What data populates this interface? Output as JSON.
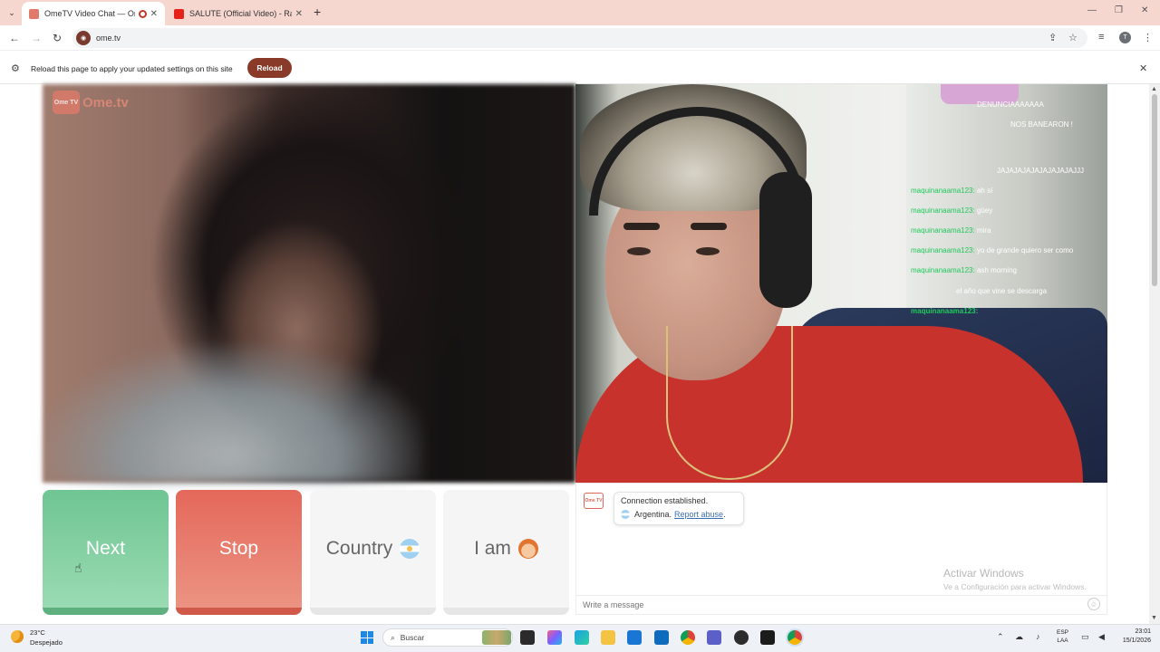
{
  "browser": {
    "tabs": [
      {
        "title": "OmeTV Video Chat — Ome",
        "active": true
      },
      {
        "title": "SALUTE (Official Video) - Raj M",
        "active": false
      }
    ],
    "new_tab": "+",
    "url": "ome.tv"
  },
  "infobar": {
    "text": "Reload this page to apply your updated settings on this site",
    "reload_label": "Reload"
  },
  "logo": {
    "badge": "Ome TV",
    "text": "Ome.tv"
  },
  "overlay_chat": [
    {
      "user": "",
      "msg": "DENUNCIAAAAAAA"
    },
    {
      "user": "",
      "msg": "NOS BANEARON !"
    },
    {
      "user": "",
      "msg": "JAJAJAJAJAJAJAJAJAJJJ"
    },
    {
      "user": "maquinanaama123:",
      "msg": " ah sí"
    },
    {
      "user": "maquinanaama123:",
      "msg": " güey"
    },
    {
      "user": "maquinanaama123:",
      "msg": " mira"
    },
    {
      "user": "maquinanaama123:",
      "msg": " yo de grande quiero ser como"
    },
    {
      "user": "maquinanaama123:",
      "msg": " ash morning"
    },
    {
      "user": "",
      "msg": "el año que vine se descarga"
    },
    {
      "user": "maquinanaama123:",
      "msg": ""
    }
  ],
  "controls": {
    "next": "Next",
    "stop": "Stop",
    "country": "Country",
    "iam": "I am"
  },
  "chat": {
    "logo": "Ome TV",
    "status": "Connection established.",
    "country": "Argentina.",
    "report": "Report abuse",
    "report_suffix": ".",
    "placeholder": "Write a message"
  },
  "watermark": {
    "title": "Activar Windows",
    "subtitle": "Ve a Configuración para activar Windows."
  },
  "taskbar": {
    "temperature": "23°C",
    "condition": "Despejado",
    "search_label": "Buscar",
    "lang_top": "ESP",
    "lang_bottom": "LAA",
    "time": "23:01",
    "date": "15/1/2026"
  }
}
